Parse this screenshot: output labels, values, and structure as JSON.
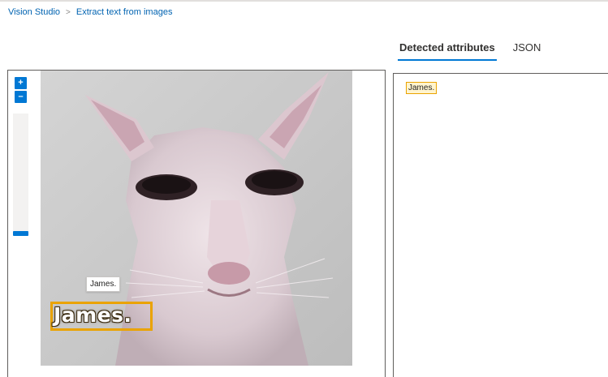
{
  "breadcrumb": {
    "items": [
      "Vision Studio",
      "Extract text from images"
    ],
    "separator": ">"
  },
  "tabs": [
    {
      "label": "Detected attributes",
      "active": true
    },
    {
      "label": "JSON",
      "active": false
    }
  ],
  "zoom": {
    "in_label": "+",
    "out_label": "–",
    "level": 0
  },
  "image": {
    "detected_text": "James.",
    "hover_label": "James."
  },
  "results": {
    "attributes": [
      "James."
    ]
  },
  "colors": {
    "accent": "#0078d4",
    "highlight_border": "#eaa300",
    "highlight_fill": "#fff4ce",
    "link": "#0063b1"
  }
}
